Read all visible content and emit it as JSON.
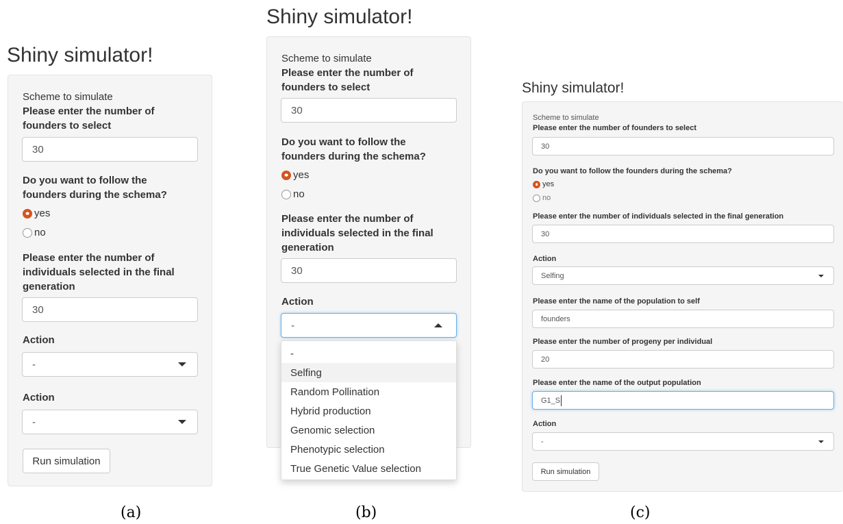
{
  "panel_a": {
    "title": "Shiny simulator!",
    "scheme_label": "Scheme to simulate",
    "founders_label": "Please enter the number of founders to select",
    "founders_value": "30",
    "follow_label": "Do you want to follow the founders during the schema?",
    "radio_yes": "yes",
    "radio_no": "no",
    "individuals_label": "Please enter the number of individuals selected in the final generation",
    "individuals_value": "30",
    "action1_label": "Action",
    "action1_value": "-",
    "action2_label": "Action",
    "action2_value": "-",
    "run_button": "Run simulation",
    "caption": "(a)"
  },
  "panel_b": {
    "title": "Shiny simulator!",
    "scheme_label": "Scheme to simulate",
    "founders_label": "Please enter the number of founders to select",
    "founders_value": "30",
    "follow_label": "Do you want to follow the founders during the schema?",
    "radio_yes": "yes",
    "radio_no": "no",
    "individuals_label": "Please enter the number of individuals selected in the final generation",
    "individuals_value": "30",
    "action_label": "Action",
    "action_value": "-",
    "dropdown_options": [
      "-",
      "Selfing",
      "Random Pollination",
      "Hybrid production",
      "Genomic selection",
      "Phenotypic selection",
      "True Genetic Value selection"
    ],
    "highlighted_option": "Selfing",
    "caption": "(b)"
  },
  "panel_c": {
    "title": "Shiny simulator!",
    "scheme_label": "Scheme to simulate",
    "founders_label": "Please enter the number of founders to select",
    "founders_value": "30",
    "follow_label": "Do you want to follow the founders during the schema?",
    "radio_yes": "yes",
    "radio_no": "no",
    "individuals_label": "Please enter the number of individuals selected in the final generation",
    "individuals_value": "30",
    "action1_label": "Action",
    "action1_value": "Selfing",
    "population_label": "Please enter the name of the population to self",
    "population_value": "founders",
    "progeny_label": "Please enter the number of progeny per individual",
    "progeny_value": "20",
    "output_label": "Please enter the name of the output population",
    "output_value": "G1_S",
    "action2_label": "Action",
    "action2_value": "-",
    "run_button": "Run simulation",
    "caption": "(c)"
  },
  "colors": {
    "radio_selected": "#d4541f",
    "panel_bg": "#f5f5f5",
    "focus_border": "#66afe9"
  }
}
